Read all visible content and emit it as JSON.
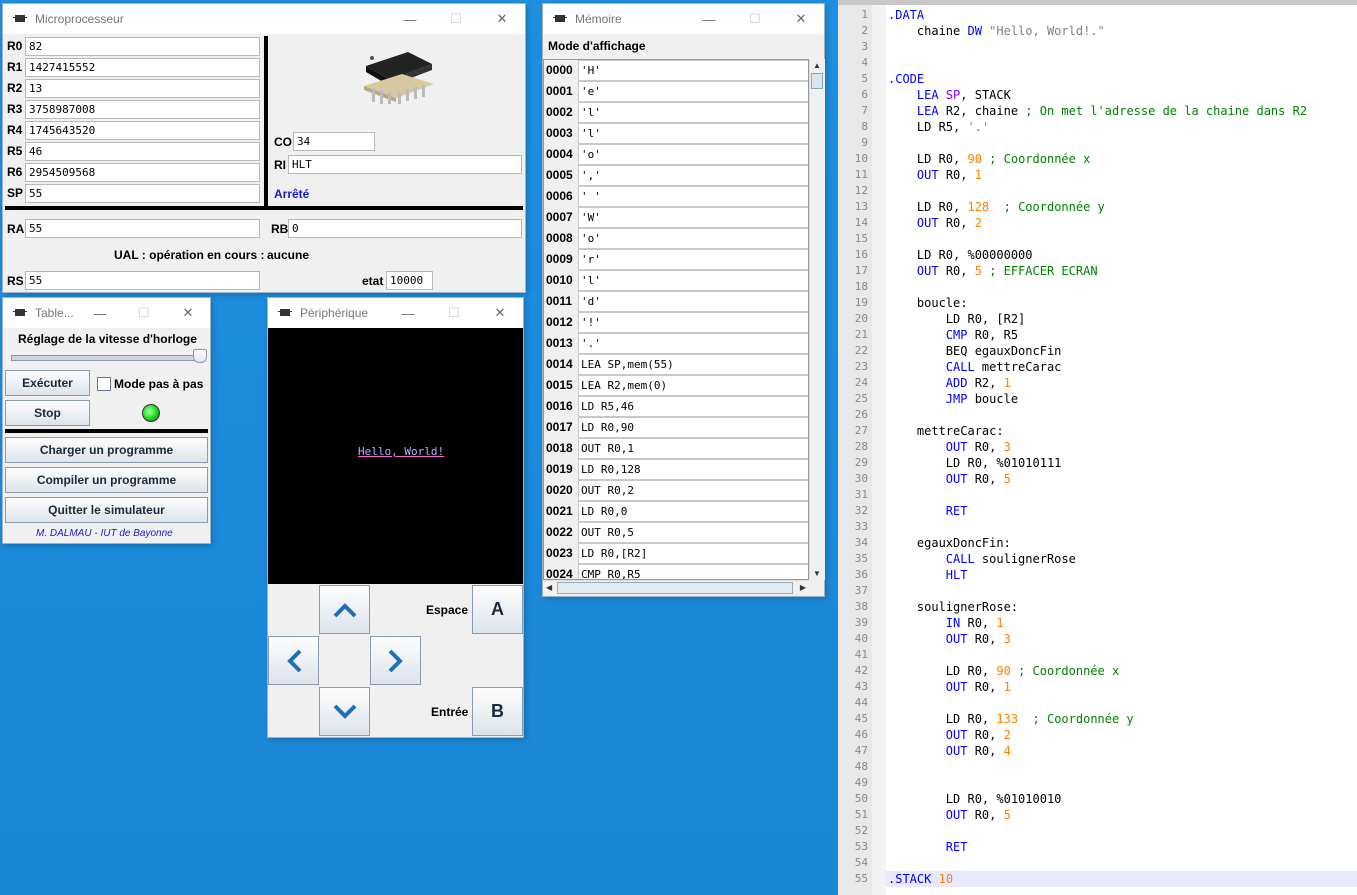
{
  "windows": {
    "cpu": {
      "title": "Microprocesseur",
      "min": "—",
      "max": "☐",
      "close": "✕"
    },
    "memory": {
      "title": "Mémoire",
      "min": "—",
      "max": "☐",
      "close": "✕",
      "mode_label": "Mode d'affichage"
    },
    "table": {
      "title": "Table...",
      "min": "—",
      "max": "☐",
      "close": "✕"
    },
    "peripheral": {
      "title": "Périphérique",
      "min": "—",
      "max": "☐",
      "close": "✕"
    }
  },
  "cpu": {
    "registers": [
      {
        "name": "R0",
        "value": "82"
      },
      {
        "name": "R1",
        "value": "1427415552"
      },
      {
        "name": "R2",
        "value": "13"
      },
      {
        "name": "R3",
        "value": "3758987008"
      },
      {
        "name": "R4",
        "value": "1745643520"
      },
      {
        "name": "R5",
        "value": "46"
      },
      {
        "name": "R6",
        "value": "2954509568"
      },
      {
        "name": "SP",
        "value": "55"
      }
    ],
    "co_label": "CO",
    "co_value": "34",
    "ri_label": "RI",
    "ri_value": "HLT",
    "status": "Arrêté",
    "ra_label": "RA",
    "ra_value": "55",
    "rb_label": "RB",
    "rb_value": "0",
    "ual_label": "UAL : opération en cours :",
    "ual_value": "aucune",
    "rs_label": "RS",
    "rs_value": "55",
    "etat_label": "etat",
    "etat_value": "10000"
  },
  "memory": {
    "rows": [
      {
        "addr": "0000",
        "val": "'H'"
      },
      {
        "addr": "0001",
        "val": "'e'"
      },
      {
        "addr": "0002",
        "val": "'l'"
      },
      {
        "addr": "0003",
        "val": "'l'"
      },
      {
        "addr": "0004",
        "val": "'o'"
      },
      {
        "addr": "0005",
        "val": "','"
      },
      {
        "addr": "0006",
        "val": "' '"
      },
      {
        "addr": "0007",
        "val": "'W'"
      },
      {
        "addr": "0008",
        "val": "'o'"
      },
      {
        "addr": "0009",
        "val": "'r'"
      },
      {
        "addr": "0010",
        "val": "'l'"
      },
      {
        "addr": "0011",
        "val": "'d'"
      },
      {
        "addr": "0012",
        "val": "'!'"
      },
      {
        "addr": "0013",
        "val": "'.'"
      },
      {
        "addr": "0014",
        "val": "LEA SP,mem(55)"
      },
      {
        "addr": "0015",
        "val": "LEA R2,mem(0)"
      },
      {
        "addr": "0016",
        "val": "LD R5,46"
      },
      {
        "addr": "0017",
        "val": "LD R0,90"
      },
      {
        "addr": "0018",
        "val": "OUT R0,1"
      },
      {
        "addr": "0019",
        "val": "LD R0,128"
      },
      {
        "addr": "0020",
        "val": "OUT R0,2"
      },
      {
        "addr": "0021",
        "val": "LD R0,0"
      },
      {
        "addr": "0022",
        "val": "OUT R0,5"
      },
      {
        "addr": "0023",
        "val": "LD R0,[R2]"
      },
      {
        "addr": "0024",
        "val": "CMP R0,R5"
      }
    ]
  },
  "table": {
    "clock_label": "Réglage de la vitesse d'horloge",
    "clock_speed": 1.0,
    "execute": "Exécuter",
    "step_mode": "Mode pas à pas",
    "stop": "Stop",
    "load": "Charger un programme",
    "compile": "Compiler un programme",
    "quit": "Quitter le simulateur",
    "credit": "M. DALMAU - IUT de Bayonne"
  },
  "peripheral": {
    "screen_text": "Hello, World!",
    "space_label": "Espace",
    "enter_label": "Entrée",
    "a_button": "A",
    "b_button": "B"
  },
  "editor": {
    "lines": [
      {
        "n": "1",
        "t": [
          {
            "c": "dir",
            "s": ".DATA"
          }
        ]
      },
      {
        "n": "2",
        "t": [
          {
            "c": "tx",
            "s": "    chaine "
          },
          {
            "c": "kw",
            "s": "DW"
          },
          {
            "c": "str",
            "s": " \"Hello, World!.\""
          }
        ]
      },
      {
        "n": "3",
        "t": []
      },
      {
        "n": "4",
        "t": []
      },
      {
        "n": "5",
        "t": [
          {
            "c": "dir",
            "s": ".CODE"
          }
        ]
      },
      {
        "n": "6",
        "t": [
          {
            "c": "tx",
            "s": "    "
          },
          {
            "c": "kw",
            "s": "LEA"
          },
          {
            "c": "tx",
            "s": " "
          },
          {
            "c": "reg",
            "s": "SP"
          },
          {
            "c": "tx",
            "s": ", STACK"
          }
        ]
      },
      {
        "n": "7",
        "t": [
          {
            "c": "tx",
            "s": "    "
          },
          {
            "c": "kw",
            "s": "LEA"
          },
          {
            "c": "tx",
            "s": " R2, chaine "
          },
          {
            "c": "cm",
            "s": "; On met l'adresse de la chaine dans R2"
          }
        ]
      },
      {
        "n": "8",
        "t": [
          {
            "c": "tx",
            "s": "    LD R5, "
          },
          {
            "c": "str",
            "s": "'.'"
          }
        ]
      },
      {
        "n": "9",
        "t": []
      },
      {
        "n": "10",
        "t": [
          {
            "c": "tx",
            "s": "    LD R0, "
          },
          {
            "c": "num",
            "s": "90"
          },
          {
            "c": "tx",
            "s": " "
          },
          {
            "c": "cm",
            "s": "; Coordonnée x"
          }
        ]
      },
      {
        "n": "11",
        "t": [
          {
            "c": "tx",
            "s": "    "
          },
          {
            "c": "kw",
            "s": "OUT"
          },
          {
            "c": "tx",
            "s": " R0, "
          },
          {
            "c": "num",
            "s": "1"
          }
        ]
      },
      {
        "n": "12",
        "t": []
      },
      {
        "n": "13",
        "t": [
          {
            "c": "tx",
            "s": "    LD R0, "
          },
          {
            "c": "num",
            "s": "128"
          },
          {
            "c": "tx",
            "s": "  "
          },
          {
            "c": "cm",
            "s": "; Coordonnée y"
          }
        ]
      },
      {
        "n": "14",
        "t": [
          {
            "c": "tx",
            "s": "    "
          },
          {
            "c": "kw",
            "s": "OUT"
          },
          {
            "c": "tx",
            "s": " R0, "
          },
          {
            "c": "num",
            "s": "2"
          }
        ]
      },
      {
        "n": "15",
        "t": []
      },
      {
        "n": "16",
        "t": [
          {
            "c": "tx",
            "s": "    LD R0, %00000000"
          }
        ]
      },
      {
        "n": "17",
        "t": [
          {
            "c": "tx",
            "s": "    "
          },
          {
            "c": "kw",
            "s": "OUT"
          },
          {
            "c": "tx",
            "s": " R0, "
          },
          {
            "c": "num",
            "s": "5"
          },
          {
            "c": "tx",
            "s": " "
          },
          {
            "c": "cm",
            "s": "; EFFACER ECRAN"
          }
        ]
      },
      {
        "n": "18",
        "t": []
      },
      {
        "n": "19",
        "t": [
          {
            "c": "tx",
            "s": "    boucle:"
          }
        ]
      },
      {
        "n": "20",
        "t": [
          {
            "c": "tx",
            "s": "        LD R0, [R2]"
          }
        ]
      },
      {
        "n": "21",
        "t": [
          {
            "c": "tx",
            "s": "        "
          },
          {
            "c": "kw",
            "s": "CMP"
          },
          {
            "c": "tx",
            "s": " R0, R5"
          }
        ]
      },
      {
        "n": "22",
        "t": [
          {
            "c": "tx",
            "s": "        BEQ egauxDoncFin"
          }
        ]
      },
      {
        "n": "23",
        "t": [
          {
            "c": "tx",
            "s": "        "
          },
          {
            "c": "kw",
            "s": "CALL"
          },
          {
            "c": "tx",
            "s": " mettreCarac"
          }
        ]
      },
      {
        "n": "24",
        "t": [
          {
            "c": "tx",
            "s": "        "
          },
          {
            "c": "kw",
            "s": "ADD"
          },
          {
            "c": "tx",
            "s": " R2, "
          },
          {
            "c": "num",
            "s": "1"
          }
        ]
      },
      {
        "n": "25",
        "t": [
          {
            "c": "tx",
            "s": "        "
          },
          {
            "c": "kw",
            "s": "JMP"
          },
          {
            "c": "tx",
            "s": " boucle"
          }
        ]
      },
      {
        "n": "26",
        "t": []
      },
      {
        "n": "27",
        "t": [
          {
            "c": "tx",
            "s": "    mettreCarac:"
          }
        ]
      },
      {
        "n": "28",
        "t": [
          {
            "c": "tx",
            "s": "        "
          },
          {
            "c": "kw",
            "s": "OUT"
          },
          {
            "c": "tx",
            "s": " R0, "
          },
          {
            "c": "num",
            "s": "3"
          }
        ]
      },
      {
        "n": "29",
        "t": [
          {
            "c": "tx",
            "s": "        LD R0, %01010111"
          }
        ]
      },
      {
        "n": "30",
        "t": [
          {
            "c": "tx",
            "s": "        "
          },
          {
            "c": "kw",
            "s": "OUT"
          },
          {
            "c": "tx",
            "s": " R0, "
          },
          {
            "c": "num",
            "s": "5"
          }
        ]
      },
      {
        "n": "31",
        "t": []
      },
      {
        "n": "32",
        "t": [
          {
            "c": "tx",
            "s": "        "
          },
          {
            "c": "kw",
            "s": "RET"
          }
        ]
      },
      {
        "n": "33",
        "t": []
      },
      {
        "n": "34",
        "t": [
          {
            "c": "tx",
            "s": "    egauxDoncFin:"
          }
        ]
      },
      {
        "n": "35",
        "t": [
          {
            "c": "tx",
            "s": "        "
          },
          {
            "c": "kw",
            "s": "CALL"
          },
          {
            "c": "tx",
            "s": " soulignerRose"
          }
        ]
      },
      {
        "n": "36",
        "t": [
          {
            "c": "tx",
            "s": "        "
          },
          {
            "c": "kw",
            "s": "HLT"
          }
        ]
      },
      {
        "n": "37",
        "t": []
      },
      {
        "n": "38",
        "t": [
          {
            "c": "tx",
            "s": "    soulignerRose:"
          }
        ]
      },
      {
        "n": "39",
        "t": [
          {
            "c": "tx",
            "s": "        "
          },
          {
            "c": "kw",
            "s": "IN"
          },
          {
            "c": "tx",
            "s": " R0, "
          },
          {
            "c": "num",
            "s": "1"
          }
        ]
      },
      {
        "n": "40",
        "t": [
          {
            "c": "tx",
            "s": "        "
          },
          {
            "c": "kw",
            "s": "OUT"
          },
          {
            "c": "tx",
            "s": " R0, "
          },
          {
            "c": "num",
            "s": "3"
          }
        ]
      },
      {
        "n": "41",
        "t": []
      },
      {
        "n": "42",
        "t": [
          {
            "c": "tx",
            "s": "        LD R0, "
          },
          {
            "c": "num",
            "s": "90"
          },
          {
            "c": "tx",
            "s": " "
          },
          {
            "c": "cm",
            "s": "; Coordonnée x"
          }
        ]
      },
      {
        "n": "43",
        "t": [
          {
            "c": "tx",
            "s": "        "
          },
          {
            "c": "kw",
            "s": "OUT"
          },
          {
            "c": "tx",
            "s": " R0, "
          },
          {
            "c": "num",
            "s": "1"
          }
        ]
      },
      {
        "n": "44",
        "t": []
      },
      {
        "n": "45",
        "t": [
          {
            "c": "tx",
            "s": "        LD R0, "
          },
          {
            "c": "num",
            "s": "133"
          },
          {
            "c": "tx",
            "s": "  "
          },
          {
            "c": "cm",
            "s": "; Coordonnée y"
          }
        ]
      },
      {
        "n": "46",
        "t": [
          {
            "c": "tx",
            "s": "        "
          },
          {
            "c": "kw",
            "s": "OUT"
          },
          {
            "c": "tx",
            "s": " R0, "
          },
          {
            "c": "num",
            "s": "2"
          }
        ]
      },
      {
        "n": "47",
        "t": [
          {
            "c": "tx",
            "s": "        "
          },
          {
            "c": "kw",
            "s": "OUT"
          },
          {
            "c": "tx",
            "s": " R0, "
          },
          {
            "c": "num",
            "s": "4"
          }
        ]
      },
      {
        "n": "48",
        "t": []
      },
      {
        "n": "49",
        "t": []
      },
      {
        "n": "50",
        "t": [
          {
            "c": "tx",
            "s": "        LD R0, %01010010"
          }
        ]
      },
      {
        "n": "51",
        "t": [
          {
            "c": "tx",
            "s": "        "
          },
          {
            "c": "kw",
            "s": "OUT"
          },
          {
            "c": "tx",
            "s": " R0, "
          },
          {
            "c": "num",
            "s": "5"
          }
        ]
      },
      {
        "n": "52",
        "t": []
      },
      {
        "n": "53",
        "t": [
          {
            "c": "tx",
            "s": "        "
          },
          {
            "c": "kw",
            "s": "RET"
          }
        ]
      },
      {
        "n": "54",
        "t": []
      },
      {
        "n": "55",
        "t": [
          {
            "c": "dir",
            "s": ".STACK"
          },
          {
            "c": "tx",
            "s": " "
          },
          {
            "c": "num",
            "s": "10"
          }
        ]
      }
    ]
  },
  "colors": {
    "desktop": "#1a86d6",
    "status_blue": "#1a1acc",
    "led_green": "#22dd22",
    "screen_text": "#b0b0ff"
  }
}
